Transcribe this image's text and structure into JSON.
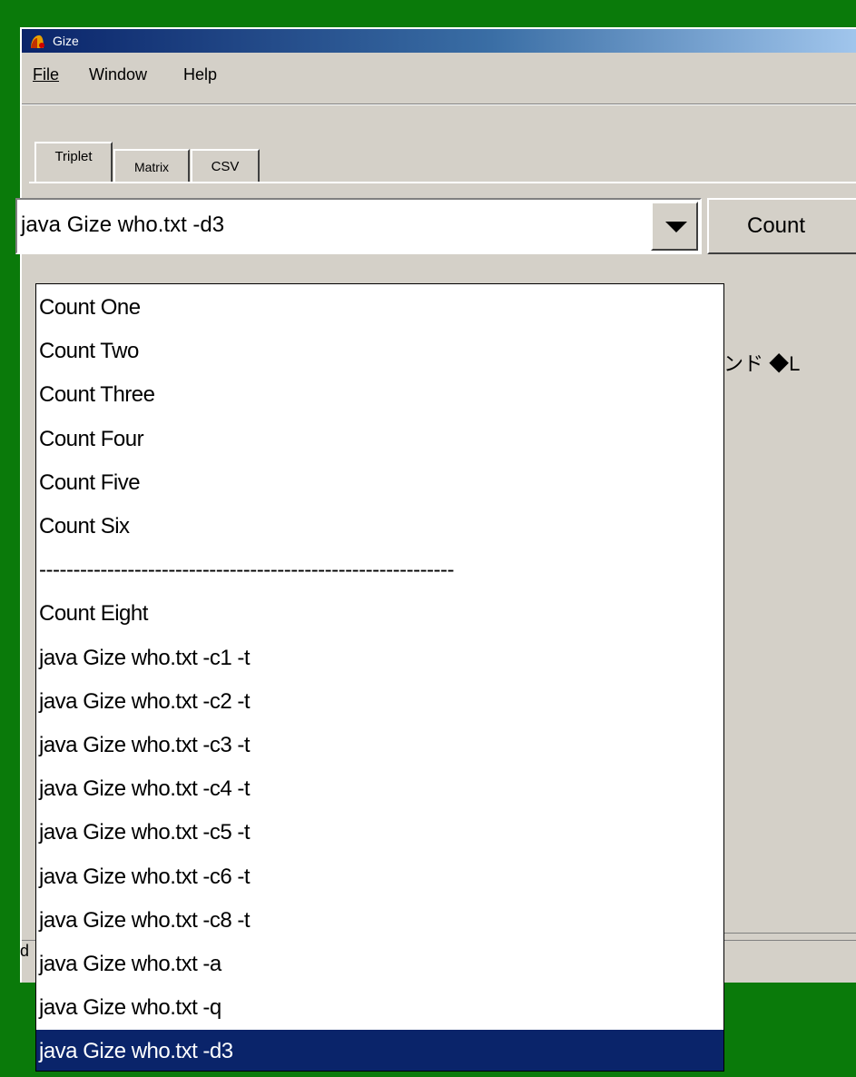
{
  "window": {
    "title": "Gize"
  },
  "menu": [
    "File",
    "Window",
    "Help"
  ],
  "tabs": [
    "Triplet",
    "Matrix",
    "CSV"
  ],
  "combo": {
    "value": "java Gize who.txt -d3"
  },
  "button": {
    "count_label": "Count"
  },
  "content": {
    "japanese_text": "ェンド ◆L"
  },
  "status": {
    "char": "d"
  },
  "dropdown": {
    "items": [
      "Count One",
      "Count Two",
      "Count Three",
      "Count Four",
      "Count Five",
      "Count Six",
      "-------------------------------------------------------------",
      "Count Eight",
      "java Gize who.txt -c1 -t",
      "java Gize who.txt -c2 -t",
      "java Gize who.txt -c3 -t",
      "java Gize who.txt -c4 -t",
      "java Gize who.txt -c5 -t",
      "java Gize who.txt -c6 -t",
      "java Gize who.txt -c8 -t",
      "java Gize who.txt -a",
      "java Gize who.txt -q",
      "java Gize who.txt -d3"
    ],
    "selected_index": 17
  },
  "colors": {
    "desktop": "#0a7a0a",
    "window_bg": "#d4d0c8",
    "titlebar_start": "#0a246a",
    "selection": "#0a246a"
  }
}
